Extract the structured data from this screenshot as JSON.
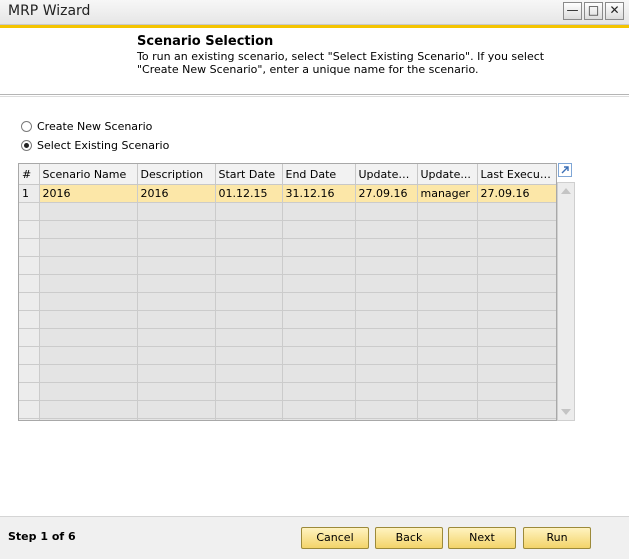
{
  "window": {
    "title": "MRP Wizard",
    "controls": [
      "minimize-icon",
      "maximize-icon",
      "close-icon"
    ]
  },
  "header": {
    "title": "Scenario Selection",
    "description": "To run an existing scenario, select \"Select Existing Scenario\". If you select \"Create New Scenario\", enter a unique name for the scenario."
  },
  "options": {
    "create_new": {
      "label": "Create New Scenario",
      "checked": false
    },
    "select_existing": {
      "label": "Select Existing Scenario",
      "checked": true
    }
  },
  "grid": {
    "columns": [
      "#",
      "Scenario Name",
      "Description",
      "Start Date",
      "End Date",
      "Updated...",
      "Update...",
      "Last Execut..."
    ],
    "rows": [
      [
        "1",
        "2016",
        "2016",
        "01.12.15",
        "31.12.16",
        "27.09.16",
        "manager",
        "27.09.16"
      ]
    ],
    "selected_row": 0,
    "empty_rows": 13
  },
  "footer": {
    "step": "Step 1 of 6",
    "buttons": {
      "cancel": "Cancel",
      "back": "Back",
      "next": "Next",
      "run": "Run"
    }
  },
  "colors": {
    "accent": "#f4c400",
    "selected_row": "#fce7a8",
    "button": "#f3d46a"
  }
}
